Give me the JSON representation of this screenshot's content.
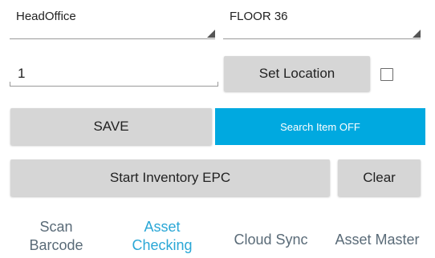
{
  "location": {
    "branch": "HeadOffice",
    "floor": "FLOOR 36",
    "quantity": "1",
    "set_location_label": "Set Location",
    "set_location_checked": false
  },
  "actions": {
    "save_label": "SAVE",
    "search_label": "Search Item OFF",
    "start_label": "Start Inventory EPC",
    "clear_label": "Clear"
  },
  "tabs": [
    {
      "line1": "Scan",
      "line2": "Barcode",
      "active": false
    },
    {
      "line1": "Asset",
      "line2": "Checking",
      "active": true
    },
    {
      "line1": "Cloud Sync",
      "line2": "",
      "active": false
    },
    {
      "line1": "Asset Master",
      "line2": "",
      "active": false
    }
  ],
  "colors": {
    "accent": "#2aa7d6",
    "button_bg": "#d6d6d6",
    "tab_text": "#5a6b78"
  }
}
